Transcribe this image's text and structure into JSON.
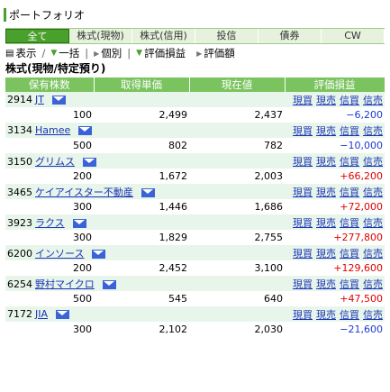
{
  "page": {
    "title": "ポートフォリオ"
  },
  "tabs": [
    "全て",
    "株式(現物)",
    "株式(信用)",
    "投信",
    "債券",
    "CW"
  ],
  "toolbar": {
    "display": "表示",
    "bulk": "一括",
    "individual": "個別",
    "eval_pnl": "評価損益",
    "eval_amount": "評価額"
  },
  "section": {
    "title": "株式(現物/特定預り)"
  },
  "table": {
    "headers": [
      "保有株数",
      "取得単価",
      "現在値",
      "評価損益"
    ],
    "actions": [
      "現買",
      "現売",
      "信買",
      "信売"
    ],
    "rows": [
      {
        "code": "2914",
        "name": "JT",
        "qty": "100",
        "cost": "2,499",
        "price": "2,437",
        "pnl": "−6,200",
        "sign": "neg"
      },
      {
        "code": "3134",
        "name": "Hamee",
        "qty": "500",
        "cost": "802",
        "price": "782",
        "pnl": "−10,000",
        "sign": "neg"
      },
      {
        "code": "3150",
        "name": "グリムス",
        "qty": "200",
        "cost": "1,672",
        "price": "2,003",
        "pnl": "+66,200",
        "sign": "pos"
      },
      {
        "code": "3465",
        "name": "ケイアイスター不動産",
        "qty": "300",
        "cost": "1,446",
        "price": "1,686",
        "pnl": "+72,000",
        "sign": "pos"
      },
      {
        "code": "3923",
        "name": "ラクス",
        "qty": "300",
        "cost": "1,829",
        "price": "2,755",
        "pnl": "+277,800",
        "sign": "pos"
      },
      {
        "code": "6200",
        "name": "インソース",
        "qty": "200",
        "cost": "2,452",
        "price": "3,100",
        "pnl": "+129,600",
        "sign": "pos"
      },
      {
        "code": "6254",
        "name": "野村マイクロ",
        "qty": "500",
        "cost": "545",
        "price": "640",
        "pnl": "+47,500",
        "sign": "pos"
      },
      {
        "code": "7172",
        "name": "JIA",
        "qty": "300",
        "cost": "2,102",
        "price": "2,030",
        "pnl": "−21,600",
        "sign": "neg"
      }
    ]
  }
}
